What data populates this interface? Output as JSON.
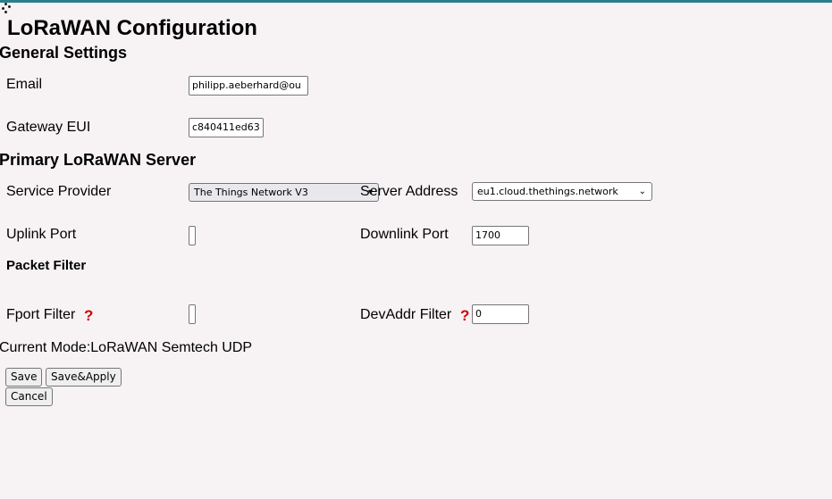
{
  "page": {
    "title": "LoRaWAN Configuration"
  },
  "general": {
    "heading": "General Settings",
    "email_label": "Email",
    "email_value": "philipp.aeberhard@ou",
    "gateway_eui_label": "Gateway EUI",
    "gateway_eui_value": "c840411ed63"
  },
  "primary": {
    "heading": "Primary LoRaWAN Server",
    "service_provider_label": "Service Provider",
    "service_provider_value": "The Things Network V3",
    "server_address_label": "Server Address",
    "server_address_value": "eu1.cloud.thethings.network",
    "uplink_port_label": "Uplink Port",
    "uplink_port_value": "",
    "downlink_port_label": "Downlink Port",
    "downlink_port_value": "1700"
  },
  "packet_filter": {
    "heading": "Packet Filter",
    "fport_label": "Fport Filter",
    "fport_help": "?",
    "fport_value": "",
    "devaddr_label": "DevAddr Filter",
    "devaddr_help": "?",
    "devaddr_value": "0"
  },
  "status": {
    "current_mode": "Current Mode:LoRaWAN Semtech UDP"
  },
  "buttons": {
    "save": "Save",
    "save_apply": "Save&Apply",
    "cancel": "Cancel"
  },
  "colors": {
    "background": "#f7f3f5",
    "top_accent": "#2a7f8c",
    "help_mark": "#d00000"
  },
  "icons": {
    "loading": "spinner-icon",
    "dropdown": "chevron-down-icon",
    "help": "question-mark-icon"
  }
}
